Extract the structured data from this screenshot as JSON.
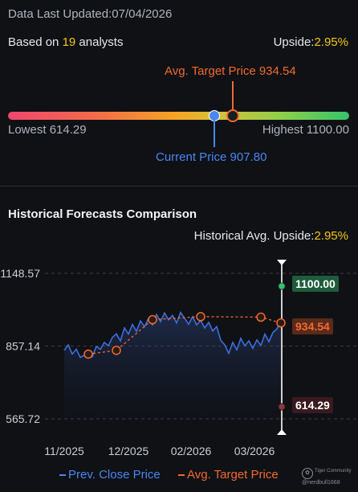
{
  "header": {
    "updated_label": "Data Last Updated:",
    "updated_date": "07/04/2026"
  },
  "summary": {
    "based_prefix": "Based on ",
    "analyst_count": "19",
    "based_suffix": " analysts",
    "upside_label": "Upside:",
    "upside_value": "2.95%"
  },
  "range": {
    "avg_target_label": "Avg. Target Price 934.54",
    "current_label": "Current Price 907.80",
    "lowest_label": "Lowest 614.29",
    "highest_label": "Highest 1100.00",
    "lowest": 614.29,
    "highest": 1100.0,
    "current": 907.8,
    "avg_target": 934.54
  },
  "historical": {
    "title": "Historical Forecasts Comparison",
    "avg_upside_label": "Historical Avg. Upside:",
    "avg_upside_value": "2.95%"
  },
  "chart_data": {
    "type": "line",
    "y_ticks": [
      "1148.57",
      "857.14",
      "565.72"
    ],
    "x_ticks": [
      "11/2025",
      "12/2025",
      "02/2026",
      "03/2026"
    ],
    "ylim": [
      565.72,
      1148.57
    ],
    "series": [
      {
        "name": "Prev. Close Price",
        "color": "#3b6fe0",
        "values": [
          840,
          862,
          825,
          845,
          812,
          820,
          836,
          815,
          856,
          844,
          872,
          858,
          892,
          906,
          878,
          930,
          905,
          944,
          916,
          958,
          935,
          968,
          942,
          984,
          955,
          990,
          962,
          980,
          950,
          992,
          968,
          945,
          975,
          942,
          960,
          930,
          952,
          918,
          935,
          880,
          862,
          828,
          872,
          842,
          888,
          858,
          878,
          848,
          882,
          860,
          905,
          875,
          912,
          926,
          960
        ]
      },
      {
        "name": "Avg. Target Price",
        "color": "#f26a2e",
        "values": [
          null,
          null,
          null,
          null,
          null,
          null,
          825,
          null,
          null,
          null,
          null,
          null,
          null,
          840,
          null,
          null,
          null,
          null,
          null,
          null,
          null,
          null,
          963,
          null,
          null,
          null,
          null,
          null,
          null,
          null,
          null,
          null,
          null,
          null,
          975,
          null,
          null,
          null,
          null,
          null,
          null,
          null,
          null,
          null,
          null,
          null,
          null,
          null,
          null,
          973,
          null,
          null,
          null,
          null,
          950
        ]
      }
    ],
    "markers": {
      "high": "1100.00",
      "target": "934.54",
      "low": "614.29"
    }
  },
  "legend": {
    "prev_close": "Prev. Close Price",
    "avg_target": "Avg. Target Price"
  },
  "watermark": {
    "brand": "Tiger Community",
    "handle": "@nerdbull1668"
  }
}
